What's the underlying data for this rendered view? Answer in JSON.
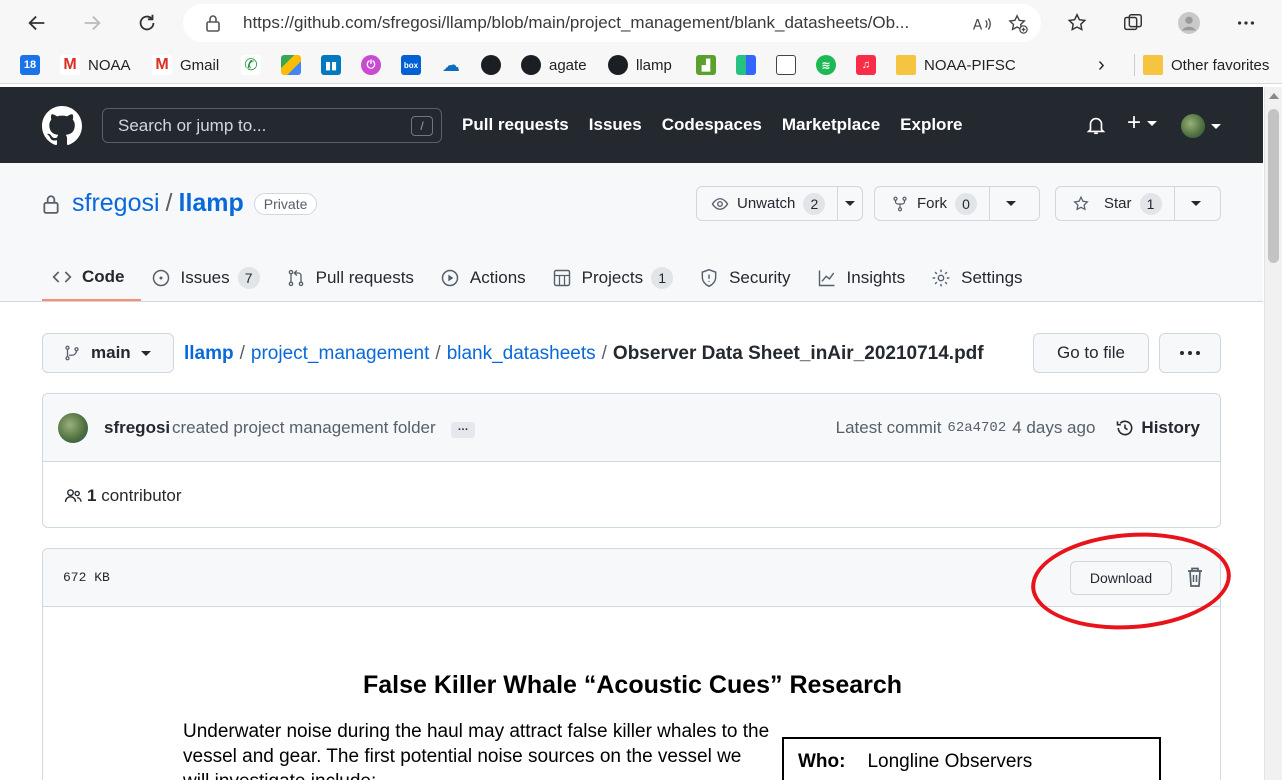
{
  "browser": {
    "url": "https://github.com/sfregosi/llamp/blob/main/project_management/blank_datasheets/Ob...",
    "bookmarks": {
      "calendar_badge": "18",
      "noaa": "NOAA",
      "gmail": "Gmail",
      "agate": "agate",
      "llamp": "llamp",
      "noaa_pifsc": "NOAA-PIFSC",
      "other_favorites": "Other favorites"
    }
  },
  "github": {
    "search_placeholder": "Search or jump to...",
    "search_shortcut": "/",
    "nav": {
      "pull_requests": "Pull requests",
      "issues": "Issues",
      "codespaces": "Codespaces",
      "marketplace": "Marketplace",
      "explore": "Explore"
    },
    "plus": "+"
  },
  "repo": {
    "owner": "sfregosi",
    "separator": "/",
    "name": "llamp",
    "visibility": "Private",
    "unwatch_label": "Unwatch",
    "watch_count": "2",
    "fork_label": "Fork",
    "fork_count": "0",
    "star_label": "Star",
    "star_count": "1",
    "tabs": {
      "code": "Code",
      "issues": "Issues",
      "issues_count": "7",
      "pull_requests": "Pull requests",
      "actions": "Actions",
      "projects": "Projects",
      "projects_count": "1",
      "security": "Security",
      "insights": "Insights",
      "settings": "Settings"
    }
  },
  "file_nav": {
    "branch": "main",
    "path": [
      "llamp",
      "project_management",
      "blank_datasheets"
    ],
    "separator": "/",
    "filename": "Observer Data Sheet_inAir_20210714.pdf",
    "go_to_file": "Go to file"
  },
  "commit": {
    "author": "sfregosi",
    "message": "created project management folder",
    "ellipsis": "…",
    "latest_label": "Latest commit",
    "sha": "62a4702",
    "time": "4 days ago",
    "history_label": "History",
    "contributor_count": "1",
    "contributor_label": "contributor"
  },
  "file": {
    "size": "672 KB",
    "download_label": "Download"
  },
  "pdf": {
    "title": "False Killer Whale “Acoustic Cues” Research",
    "body": "Underwater noise during the haul may attract false killer whales to the vessel and gear. The first potential noise sources on the vessel we will investigate include:",
    "who_label": "Who:",
    "who_value": "Longline Observers"
  },
  "colors": {
    "header_bg": "#24292f",
    "link": "#0969da",
    "active_tab_underline": "#fd8c73",
    "annotation": "#e8141b"
  }
}
